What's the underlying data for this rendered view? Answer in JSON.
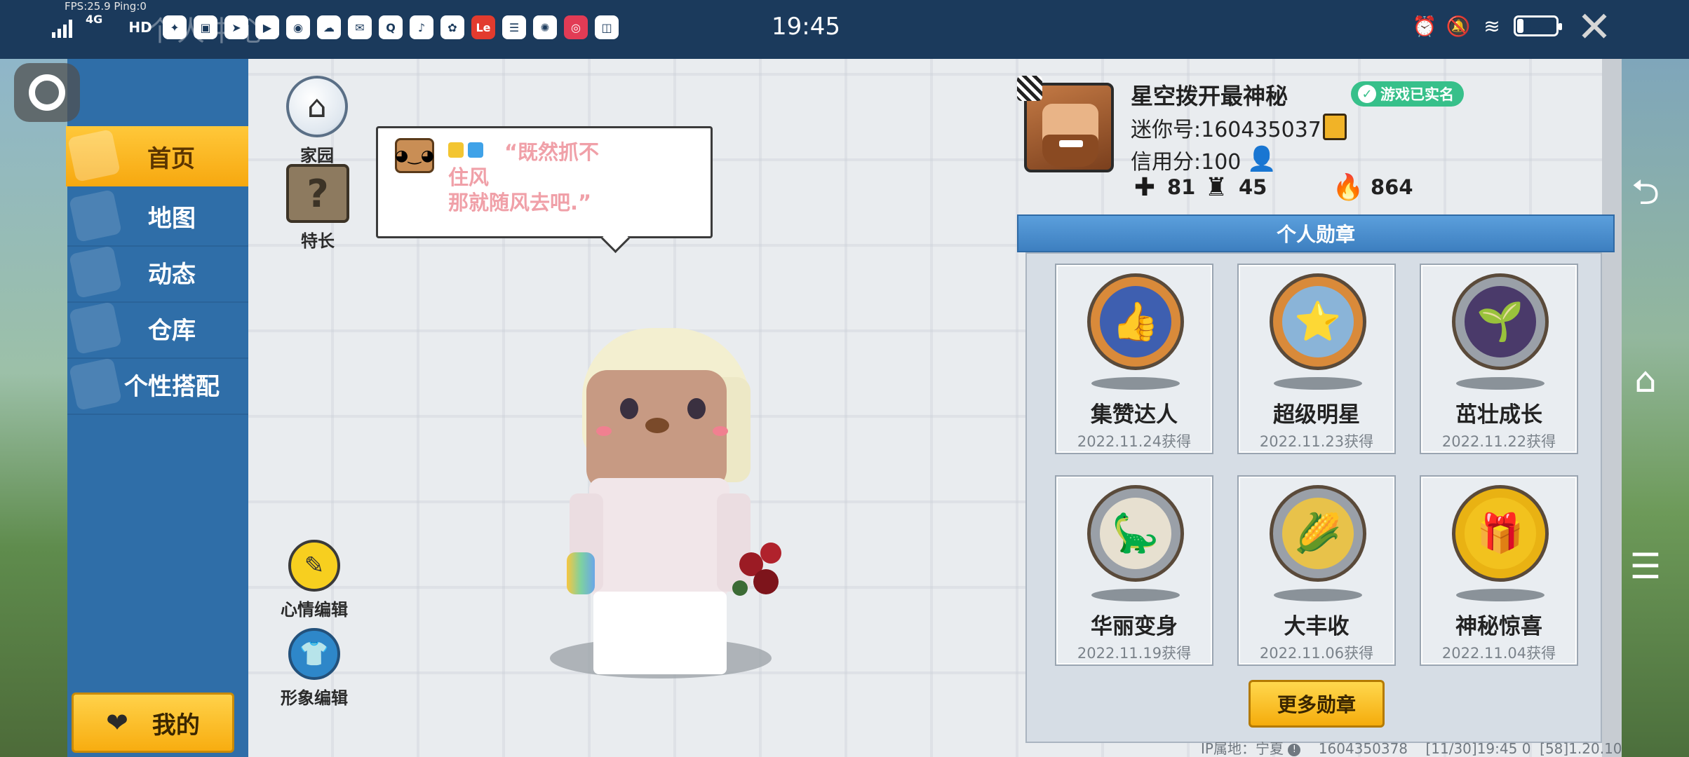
{
  "status_bar": {
    "fps": "FPS:25.9  Ping:0",
    "network": "4G",
    "hd": "HD",
    "app_icons": [
      "wechat-icon",
      "tv-icon",
      "direct-icon",
      "video-icon",
      "compass-icon",
      "cloud-icon",
      "mail-icon",
      "quark-icon",
      "tiktok-icon",
      "game-icon",
      "le-icon",
      "mi-icon",
      "fan-icon",
      "camera-icon",
      "app-icon"
    ],
    "le_label": "Le",
    "ghost_title": "个人中心",
    "time": "19:45",
    "battery": "17",
    "battery_percent": 17
  },
  "sidebar": {
    "items": [
      {
        "label": "首页",
        "active": true
      },
      {
        "label": "地图",
        "active": false
      },
      {
        "label": "动态",
        "active": false
      },
      {
        "label": "仓库",
        "active": false
      },
      {
        "label": "个性搭配",
        "active": false
      }
    ],
    "mine_label": "我的"
  },
  "side_actions": {
    "home_label": "家园",
    "specialty_label": "特长",
    "specialty_glyph": "?",
    "mood_edit_label": "心情编辑",
    "appearance_edit_label": "形象编辑"
  },
  "mood": {
    "line1": "“既然抓不",
    "line2": "住风",
    "line3": "那就随风去吧.”"
  },
  "profile": {
    "nickname": "星空拨开最神秘",
    "realname_badge": "游戏已实名",
    "uid": "迷你号:1604350378",
    "credit": "信用分:100",
    "stats": [
      {
        "icon": "plus-bookmark-icon",
        "value": "81"
      },
      {
        "icon": "fans-icon",
        "value": "45"
      },
      {
        "icon": "fire-icon",
        "value": "864"
      }
    ]
  },
  "medals": {
    "title": "个人勋章",
    "items": [
      {
        "name": "集赞达人",
        "date": "2022.11.24获得",
        "color": "#d98a3a",
        "inner": "#3e5fb0",
        "glyph": "👍"
      },
      {
        "name": "超级明星",
        "date": "2022.11.23获得",
        "color": "#d98a3a",
        "inner": "#8ab4d8",
        "glyph": "⭐"
      },
      {
        "name": "茁壮成长",
        "date": "2022.11.22获得",
        "color": "#9aa0a8",
        "inner": "#4a3a6a",
        "glyph": "🌱"
      },
      {
        "name": "华丽变身",
        "date": "2022.11.19获得",
        "color": "#9aa0a8",
        "inner": "#e7e0d0",
        "glyph": "🦕"
      },
      {
        "name": "大丰收",
        "date": "2022.11.06获得",
        "color": "#9aa0a8",
        "inner": "#e8c24a",
        "glyph": "🌽"
      },
      {
        "name": "神秘惊喜",
        "date": "2022.11.04获得",
        "color": "#e9b213",
        "inner": "#f2c21e",
        "glyph": "🎁"
      }
    ],
    "more_label": "更多勋章"
  },
  "footer": {
    "ip_location": "IP属地：宁夏",
    "uid": "1604350378",
    "time_info": "[11/30]19:45 0",
    "version": "[58]1.20.10"
  }
}
